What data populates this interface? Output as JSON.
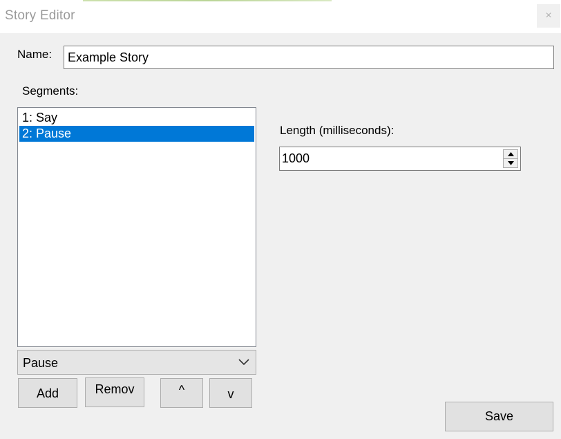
{
  "window": {
    "title": "Story Editor",
    "close_label": "×"
  },
  "name": {
    "label": "Name:",
    "value": "Example Story"
  },
  "segments": {
    "label": "Segments:",
    "items": [
      {
        "label": "1: Say",
        "selected": false
      },
      {
        "label": "2: Pause",
        "selected": true
      }
    ],
    "type_select": {
      "value": "Pause"
    },
    "buttons": {
      "add": "Add",
      "remove": "Remov",
      "up": "^",
      "down": "v"
    }
  },
  "length": {
    "label": "Length (milliseconds):",
    "value": "1000"
  },
  "actions": {
    "save": "Save"
  },
  "colors": {
    "selection": "#0078d7",
    "window_bg": "#f0f0f0",
    "title_text": "#9a9a9a"
  },
  "icons": {
    "close": "close-icon",
    "dropdown": "chevron-down-icon",
    "spin_up": "triangle-up-icon",
    "spin_down": "triangle-down-icon"
  }
}
